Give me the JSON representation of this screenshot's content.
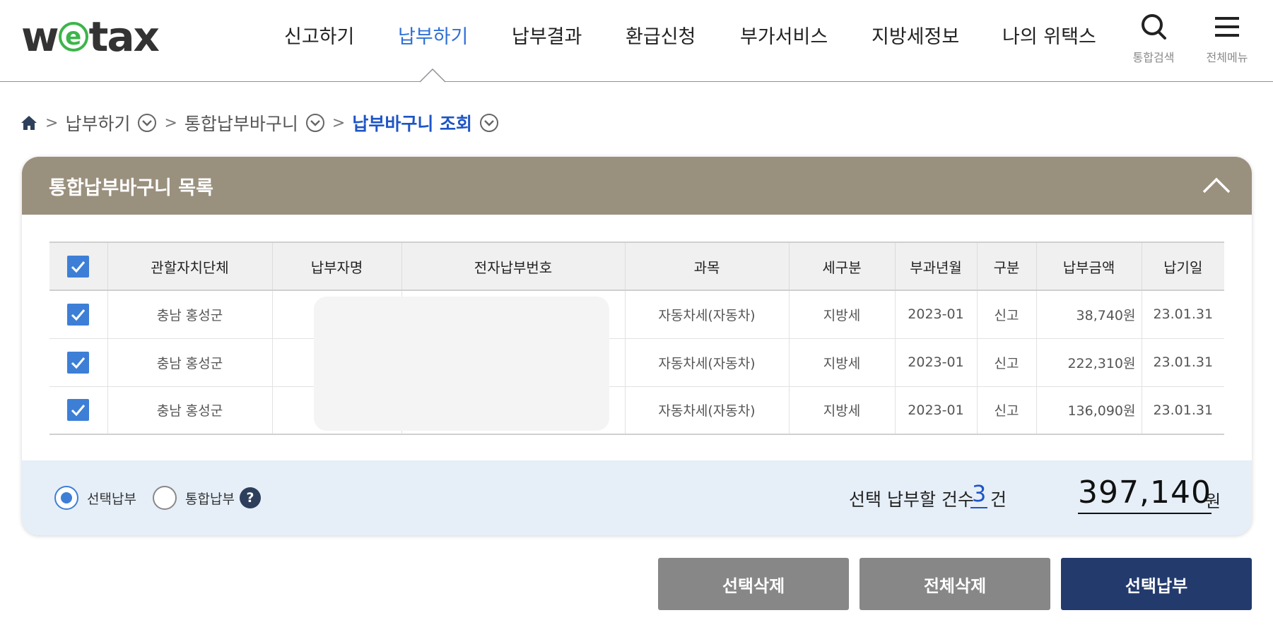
{
  "header": {
    "logo": {
      "pre": "w",
      "mark": "e",
      "post": "tax"
    },
    "nav": [
      "신고하기",
      "납부하기",
      "납부결과",
      "환급신청",
      "부가서비스",
      "지방세정보",
      "나의 위택스"
    ],
    "active_nav": "납부하기",
    "search_label": "통합검색",
    "menu_label": "전체메뉴"
  },
  "breadcrumb": {
    "items": [
      "납부하기",
      "통합납부바구니",
      "납부바구니 조회"
    ]
  },
  "panel": {
    "title": "통합납부바구니 목록",
    "columns": [
      "관할자치단체",
      "납부자명",
      "전자납부번호",
      "과목",
      "세구분",
      "부과년월",
      "구분",
      "납부금액",
      "납기일"
    ],
    "rows": [
      {
        "region": "충남 홍성군",
        "payer": "",
        "epay_no": "",
        "item": "자동차세(자동차)",
        "tax_type": "지방세",
        "period": "2023-01",
        "kind": "신고",
        "amount": "38,740원",
        "due": "23.01.31",
        "checked": true
      },
      {
        "region": "충남 홍성군",
        "payer": "",
        "epay_no": "",
        "item": "자동차세(자동차)",
        "tax_type": "지방세",
        "period": "2023-01",
        "kind": "신고",
        "amount": "222,310원",
        "due": "23.01.31",
        "checked": true
      },
      {
        "region": "충남 홍성군",
        "payer": "",
        "epay_no": "",
        "item": "자동차세(자동차)",
        "tax_type": "지방세",
        "period": "2023-01",
        "kind": "신고",
        "amount": "136,090원",
        "due": "23.01.31",
        "checked": true
      }
    ]
  },
  "summary": {
    "radio_selected": "선택납부",
    "radio_combined": "통합납부",
    "help_glyph": "?",
    "count_label": "선택 납부할 건수",
    "count_value": "3",
    "count_unit": "건",
    "total_value": "397,140",
    "total_unit": "원"
  },
  "buttons": {
    "delete_selected": "선택삭제",
    "delete_all": "전체삭제",
    "pay_selected": "선택납부"
  },
  "colors": {
    "accent_blue": "#2f6fd6",
    "panel_header": "#9a907e",
    "summary_bg": "#e6eff8",
    "button_gray": "#878787",
    "button_navy": "#233a6d"
  }
}
